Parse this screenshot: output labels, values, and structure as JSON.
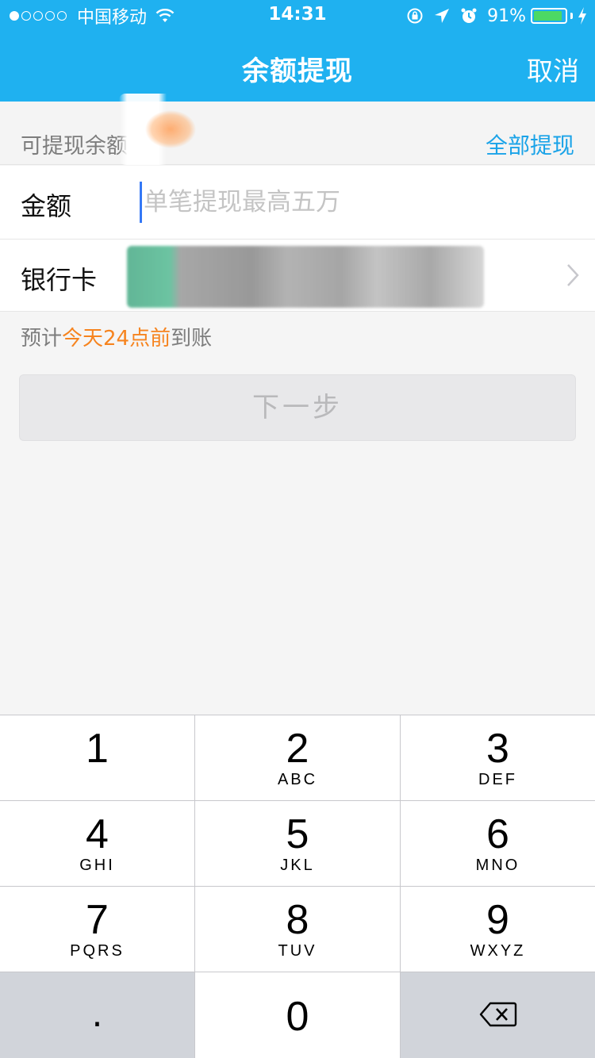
{
  "status_bar": {
    "carrier": "中国移动",
    "time": "14:31",
    "battery_percent": "91%",
    "battery_level": 0.91,
    "signal_bars_filled": 1,
    "signal_bars_total": 5,
    "icons": [
      "wifi-icon",
      "rotation-lock-icon",
      "location-icon",
      "alarm-icon",
      "battery-icon",
      "charging-icon"
    ]
  },
  "nav": {
    "title": "余额提现",
    "cancel_label": "取消"
  },
  "balance": {
    "label": "可提现余额",
    "withdraw_all_label": "全部提现"
  },
  "form": {
    "amount_label": "金额",
    "amount_placeholder": "单笔提现最高五万",
    "amount_value": "",
    "bank_label": "银行卡"
  },
  "arrival": {
    "prefix": "预计",
    "highlight": "今天24点前",
    "suffix": "到账"
  },
  "next_button_label": "下一步",
  "keypad": {
    "keys": [
      {
        "num": "1",
        "letters": ""
      },
      {
        "num": "2",
        "letters": "ABC"
      },
      {
        "num": "3",
        "letters": "DEF"
      },
      {
        "num": "4",
        "letters": "GHI"
      },
      {
        "num": "5",
        "letters": "JKL"
      },
      {
        "num": "6",
        "letters": "MNO"
      },
      {
        "num": "7",
        "letters": "PQRS"
      },
      {
        "num": "8",
        "letters": "TUV"
      },
      {
        "num": "9",
        "letters": "WXYZ"
      }
    ],
    "dot": ".",
    "zero": "0"
  },
  "colors": {
    "nav_bg": "#1fb1f0",
    "link": "#1aa3e8",
    "highlight": "#f6841f",
    "battery": "#4cd964",
    "key_gray": "#d1d4da"
  }
}
